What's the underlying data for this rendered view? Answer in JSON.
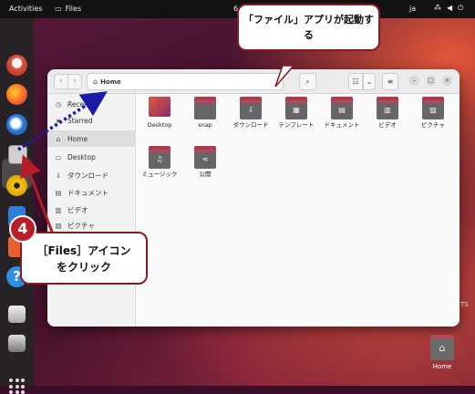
{
  "topbar": {
    "activities": "Activities",
    "app_name": "Files",
    "clock": "6",
    "lang": "ja"
  },
  "files_window": {
    "path": "Home",
    "sidebar": [
      {
        "label": "Recent",
        "icon": "clock-icon",
        "glyph": "◷"
      },
      {
        "label": "Starred",
        "icon": "star-icon",
        "glyph": "★"
      },
      {
        "label": "Home",
        "icon": "home-icon",
        "glyph": "⌂"
      },
      {
        "label": "Desktop",
        "icon": "desktop-icon",
        "glyph": "▭"
      },
      {
        "label": "ダウンロード",
        "icon": "download-icon",
        "glyph": "⇩"
      },
      {
        "label": "ドキュメント",
        "icon": "document-icon",
        "glyph": "▤"
      },
      {
        "label": "ビデオ",
        "icon": "video-icon",
        "glyph": "▥"
      },
      {
        "label": "ピクチャ",
        "icon": "picture-icon",
        "glyph": "▨"
      }
    ],
    "folders": [
      {
        "label": "Desktop",
        "icon": "desktop-folder-icon",
        "glyph": ""
      },
      {
        "label": "snap",
        "icon": "folder-icon",
        "glyph": ""
      },
      {
        "label": "ダウンロード",
        "icon": "download-folder-icon",
        "glyph": "⇩"
      },
      {
        "label": "テンプレート",
        "icon": "template-folder-icon",
        "glyph": "▦"
      },
      {
        "label": "ドキュメント",
        "icon": "document-folder-icon",
        "glyph": "▤"
      },
      {
        "label": "ビデオ",
        "icon": "video-folder-icon",
        "glyph": "▥"
      },
      {
        "label": "ピクチャ",
        "icon": "picture-folder-icon",
        "glyph": "▨"
      },
      {
        "label": "ミュージック",
        "icon": "music-folder-icon",
        "glyph": "♫"
      },
      {
        "label": "公開",
        "icon": "share-folder-icon",
        "glyph": "⋖"
      }
    ]
  },
  "callouts": {
    "top": "「ファイル」アプリが起動する",
    "bottom": "［Files］アイコンをクリック",
    "step": "4"
  },
  "desktop": {
    "home_label": "Home",
    "residual_text": "TS"
  },
  "colors": {
    "accent": "#8a1a22",
    "folder": "#a93c4e",
    "arrow_red": "#b51c28",
    "arrow_blue": "#1a1aa8"
  }
}
